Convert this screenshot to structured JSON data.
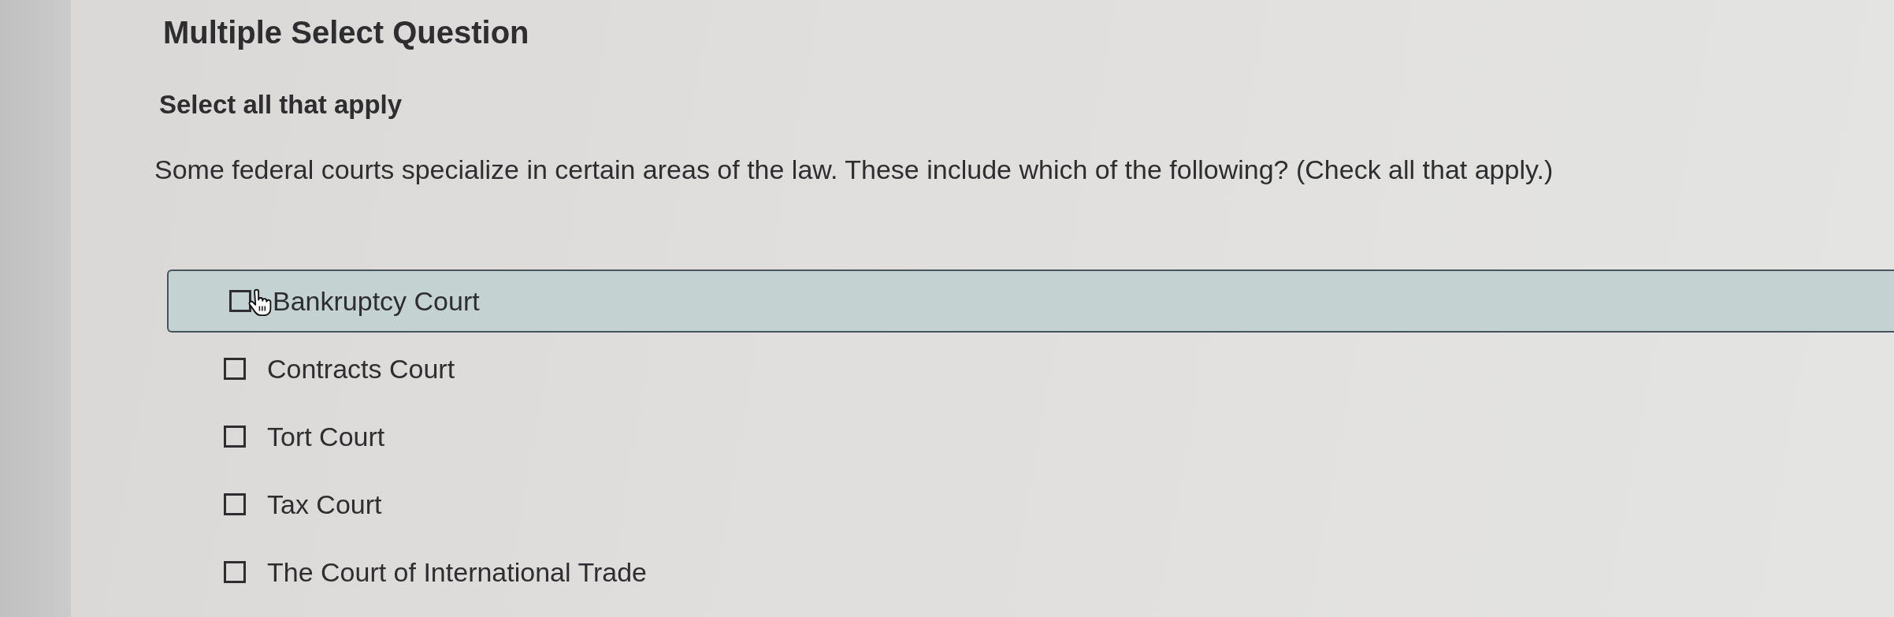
{
  "title": "Multiple Select Question",
  "instruction": "Select all that apply",
  "question": "Some federal courts specialize in certain areas of the law. These include which of the following? (Check all that apply.)",
  "options": [
    {
      "label": "Bankruptcy Court",
      "checked": false,
      "hovered": true
    },
    {
      "label": "Contracts Court",
      "checked": false,
      "hovered": false
    },
    {
      "label": "Tort Court",
      "checked": false,
      "hovered": false
    },
    {
      "label": "Tax Court",
      "checked": false,
      "hovered": false
    },
    {
      "label": "The Court of International Trade",
      "checked": false,
      "hovered": false
    }
  ]
}
